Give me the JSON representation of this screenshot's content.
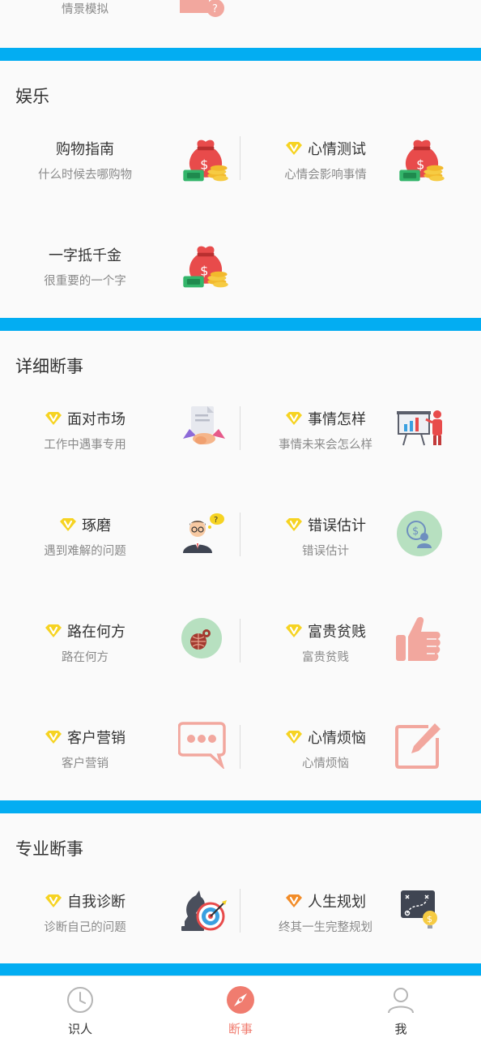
{
  "top_partial": {
    "subtitle": "情景模拟"
  },
  "sections": {
    "entertainment": {
      "title": "娱乐",
      "items": [
        {
          "title": "购物指南",
          "subtitle": "什么时候去哪购物",
          "vip": false
        },
        {
          "title": "心情测试",
          "subtitle": "心情会影响事情",
          "vip": true
        },
        {
          "title": "一字抵千金",
          "subtitle": "很重要的一个字",
          "vip": false
        }
      ]
    },
    "detailed": {
      "title": "详细断事",
      "items": [
        {
          "title": "面对市场",
          "subtitle": "工作中遇事专用",
          "vip": true
        },
        {
          "title": "事情怎样",
          "subtitle": "事情未来会怎么样",
          "vip": true
        },
        {
          "title": "琢磨",
          "subtitle": "遇到难解的问题",
          "vip": true
        },
        {
          "title": "错误估计",
          "subtitle": "错误估计",
          "vip": true
        },
        {
          "title": "路在何方",
          "subtitle": "路在何方",
          "vip": true
        },
        {
          "title": "富贵贫贱",
          "subtitle": "富贵贫贱",
          "vip": true
        },
        {
          "title": "客户营销",
          "subtitle": "客户营销",
          "vip": true
        },
        {
          "title": "心情烦恼",
          "subtitle": "心情烦恼",
          "vip": true
        }
      ]
    },
    "professional": {
      "title": "专业断事",
      "items": [
        {
          "title": "自我诊断",
          "subtitle": "诊断自己的问题",
          "vip": true
        },
        {
          "title": "人生规划",
          "subtitle": "终其一生完整规划",
          "vip": true,
          "vip_color": "orange"
        }
      ]
    }
  },
  "tabbar": {
    "tabs": [
      {
        "label": "识人",
        "icon": "clock-icon",
        "active": false
      },
      {
        "label": "断事",
        "icon": "compass-icon",
        "active": true
      },
      {
        "label": "我",
        "icon": "person-icon",
        "active": false
      }
    ]
  },
  "colors": {
    "accent_band": "#03adf2",
    "active_tab": "#f07c6f",
    "vip_yellow": "#f6d322",
    "vip_orange": "#f28c28"
  }
}
